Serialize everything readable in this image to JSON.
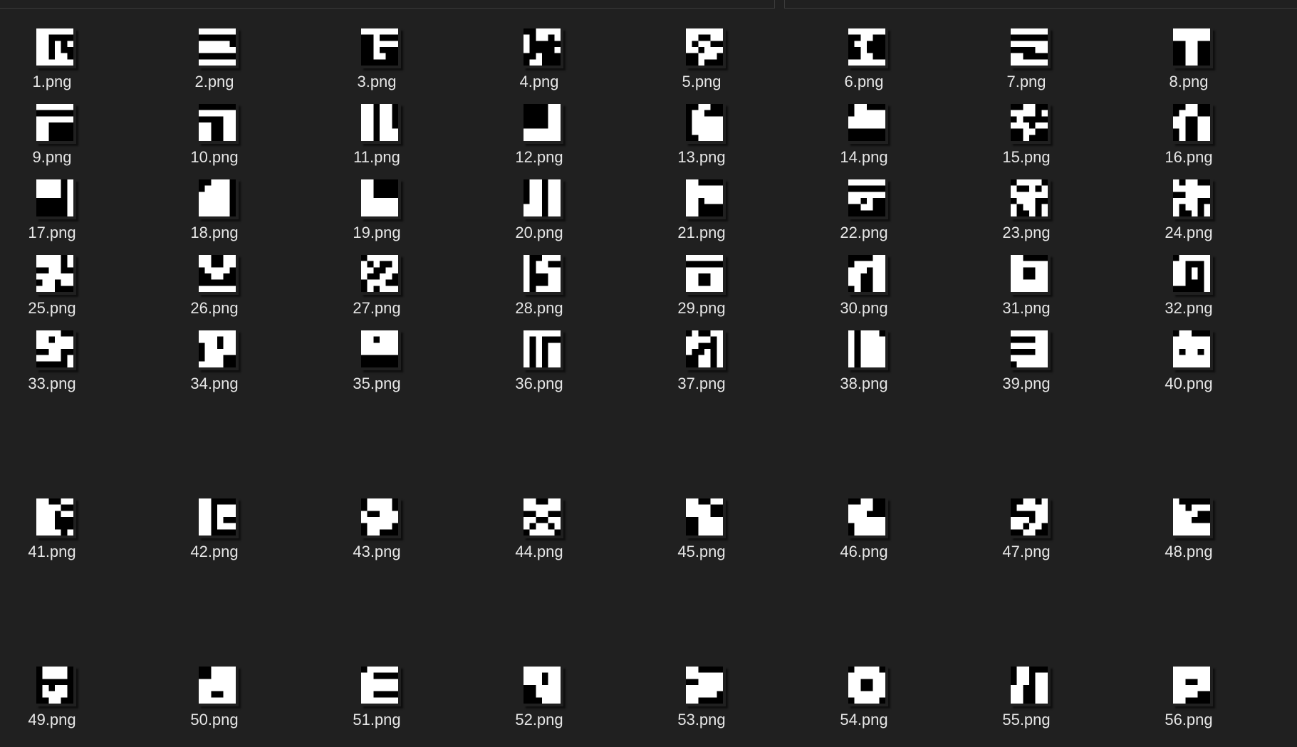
{
  "explorer": {
    "background_color": "#202020",
    "label_color": "#e6e6e6",
    "files": [
      {
        "name": "1.png",
        "pattern": [
          "111111",
          "110000",
          "110101",
          "110100",
          "110110",
          "111111"
        ]
      },
      {
        "name": "2.png",
        "pattern": [
          "111111",
          "000000",
          "111110",
          "111111",
          "000000",
          "111111"
        ]
      },
      {
        "name": "3.png",
        "pattern": [
          "111111",
          "001000",
          "001111",
          "001000",
          "001100",
          "000000"
        ]
      },
      {
        "name": "4.png",
        "pattern": [
          "001111",
          "101101",
          "100000",
          "100001",
          "001000",
          "011000"
        ]
      },
      {
        "name": "5.png",
        "pattern": [
          "111111",
          "110011",
          "101100",
          "110111",
          "001110",
          "001000"
        ]
      },
      {
        "name": "6.png",
        "pattern": [
          "111111",
          "001100",
          "011000",
          "001000",
          "001100",
          "111111"
        ]
      },
      {
        "name": "7.png",
        "pattern": [
          "111111",
          "000000",
          "111111",
          "000011",
          "110000",
          "111111"
        ]
      },
      {
        "name": "8.png",
        "pattern": [
          "111111",
          "111111",
          "001100",
          "001100",
          "001100",
          "001100"
        ]
      },
      {
        "name": "9.png",
        "pattern": [
          "111111",
          "000000",
          "111111",
          "110000",
          "110000",
          "110000"
        ]
      },
      {
        "name": "10.png",
        "pattern": [
          "000000",
          "111111",
          "000011",
          "110011",
          "110011",
          "110011"
        ]
      },
      {
        "name": "11.png",
        "pattern": [
          "110110",
          "110110",
          "110110",
          "110110",
          "110111",
          "110111"
        ]
      },
      {
        "name": "12.png",
        "pattern": [
          "000011",
          "000011",
          "000011",
          "000011",
          "111111",
          "111111"
        ]
      },
      {
        "name": "13.png",
        "pattern": [
          "001100",
          "011000",
          "011111",
          "011111",
          "011111",
          "001111"
        ]
      },
      {
        "name": "14.png",
        "pattern": [
          "011000",
          "011111",
          "111111",
          "111111",
          "000000",
          "000000"
        ]
      },
      {
        "name": "15.png",
        "pattern": [
          "001100",
          "111101",
          "010000",
          "111011",
          "001100",
          "001000"
        ]
      },
      {
        "name": "16.png",
        "pattern": [
          "001100",
          "011100",
          "110011",
          "110011",
          "010011",
          "010011"
        ]
      },
      {
        "name": "17.png",
        "pattern": [
          "111101",
          "111101",
          "111101",
          "000001",
          "000001",
          "000001"
        ]
      },
      {
        "name": "18.png",
        "pattern": [
          "001110",
          "011110",
          "111110",
          "111110",
          "111110",
          "111110"
        ]
      },
      {
        "name": "19.png",
        "pattern": [
          "110000",
          "110000",
          "110000",
          "111111",
          "111111",
          "111111"
        ]
      },
      {
        "name": "20.png",
        "pattern": [
          "011011",
          "011011",
          "011011",
          "011011",
          "111011",
          "111011"
        ]
      },
      {
        "name": "21.png",
        "pattern": [
          "110000",
          "111111",
          "111111",
          "110111",
          "110000",
          "110000"
        ]
      },
      {
        "name": "22.png",
        "pattern": [
          "111111",
          "000000",
          "111111",
          "110100",
          "001100",
          "000000"
        ]
      },
      {
        "name": "23.png",
        "pattern": [
          "011110",
          "100101",
          "111111",
          "011100",
          "101101",
          "100101"
        ]
      },
      {
        "name": "24.png",
        "pattern": [
          "101100",
          "111111",
          "001111",
          "111100",
          "101101",
          "100101"
        ]
      },
      {
        "name": "25.png",
        "pattern": [
          "111101",
          "111101",
          "001100",
          "111111",
          "011011",
          "111000"
        ]
      },
      {
        "name": "26.png",
        "pattern": [
          "110011",
          "110011",
          "011110",
          "001100",
          "000000",
          "111111"
        ]
      },
      {
        "name": "27.png",
        "pattern": [
          "011111",
          "101001",
          "110011",
          "100110",
          "011100",
          "010111"
        ]
      },
      {
        "name": "28.png",
        "pattern": [
          "100111",
          "101100",
          "101111",
          "100011",
          "100011",
          "101111"
        ]
      },
      {
        "name": "29.png",
        "pattern": [
          "111111",
          "000000",
          "111111",
          "110011",
          "110011",
          "111111"
        ]
      },
      {
        "name": "30.png",
        "pattern": [
          "000011",
          "011111",
          "111011",
          "110011",
          "110011",
          "010011"
        ]
      },
      {
        "name": "31.png",
        "pattern": [
          "110000",
          "111111",
          "110011",
          "110011",
          "111111",
          "111111"
        ]
      },
      {
        "name": "32.png",
        "pattern": [
          "011111",
          "110001",
          "110101",
          "110101",
          "110001",
          "000001"
        ]
      },
      {
        "name": "33.png",
        "pattern": [
          "111100",
          "110111",
          "111111",
          "001100",
          "111101",
          "000001"
        ]
      },
      {
        "name": "34.png",
        "pattern": [
          "111111",
          "111011",
          "011011",
          "011111",
          "011100",
          "111100"
        ]
      },
      {
        "name": "35.png",
        "pattern": [
          "111111",
          "110111",
          "111111",
          "111111",
          "000000",
          "000000"
        ]
      },
      {
        "name": "36.png",
        "pattern": [
          "111111",
          "101000",
          "101011",
          "101011",
          "101011",
          "101011"
        ]
      },
      {
        "name": "37.png",
        "pattern": [
          "010011",
          "111101",
          "110001",
          "100101",
          "001101",
          "001101"
        ]
      },
      {
        "name": "38.png",
        "pattern": [
          "101110",
          "101111",
          "101111",
          "101111",
          "101111",
          "101111"
        ]
      },
      {
        "name": "39.png",
        "pattern": [
          "111111",
          "000011",
          "111111",
          "000011",
          "111111",
          "011111"
        ]
      },
      {
        "name": "40.png",
        "pattern": [
          "011000",
          "111111",
          "111111",
          "101101",
          "111111",
          "111111"
        ]
      },
      {
        "name": "41.png",
        "pattern": [
          "110011",
          "111100",
          "111011",
          "111000",
          "111000",
          "111101"
        ]
      },
      {
        "name": "42.png",
        "pattern": [
          "110000",
          "110111",
          "110111",
          "110100",
          "110111",
          "110000"
        ]
      },
      {
        "name": "43.png",
        "pattern": [
          "011110",
          "011110",
          "100111",
          "111111",
          "011110",
          "011000"
        ]
      },
      {
        "name": "44.png",
        "pattern": [
          "110011",
          "111111",
          "001100",
          "110011",
          "101101",
          "011110"
        ]
      },
      {
        "name": "45.png",
        "pattern": [
          "110011",
          "111100",
          "111100",
          "001111",
          "001111",
          "001111"
        ]
      },
      {
        "name": "46.png",
        "pattern": [
          "001100",
          "111100",
          "111000",
          "111111",
          "011111",
          "011111"
        ]
      },
      {
        "name": "47.png",
        "pattern": [
          "001101",
          "011111",
          "000011",
          "111011",
          "110110",
          "001100"
        ]
      },
      {
        "name": "48.png",
        "pattern": [
          "100000",
          "110111",
          "111100",
          "111000",
          "111111",
          "111111"
        ]
      },
      {
        "name": "49.png",
        "pattern": [
          "011110",
          "011110",
          "000000",
          "010110",
          "011110",
          "001100"
        ]
      },
      {
        "name": "50.png",
        "pattern": [
          "001111",
          "001111",
          "111111",
          "111111",
          "110011",
          "111111"
        ]
      },
      {
        "name": "51.png",
        "pattern": [
          "011111",
          "110000",
          "111111",
          "111111",
          "110000",
          "111111"
        ]
      },
      {
        "name": "52.png",
        "pattern": [
          "111111",
          "111011",
          "111011",
          "001111",
          "001111",
          "000111"
        ]
      },
      {
        "name": "53.png",
        "pattern": [
          "110000",
          "111111",
          "001111",
          "111111",
          "111110",
          "110000"
        ]
      },
      {
        "name": "54.png",
        "pattern": [
          "011110",
          "111111",
          "110011",
          "110011",
          "111111",
          "011110"
        ]
      },
      {
        "name": "55.png",
        "pattern": [
          "011000",
          "011011",
          "011011",
          "110011",
          "110011",
          "110011"
        ]
      },
      {
        "name": "56.png",
        "pattern": [
          "111111",
          "111111",
          "110011",
          "111111",
          "111100",
          "110000"
        ]
      }
    ]
  }
}
